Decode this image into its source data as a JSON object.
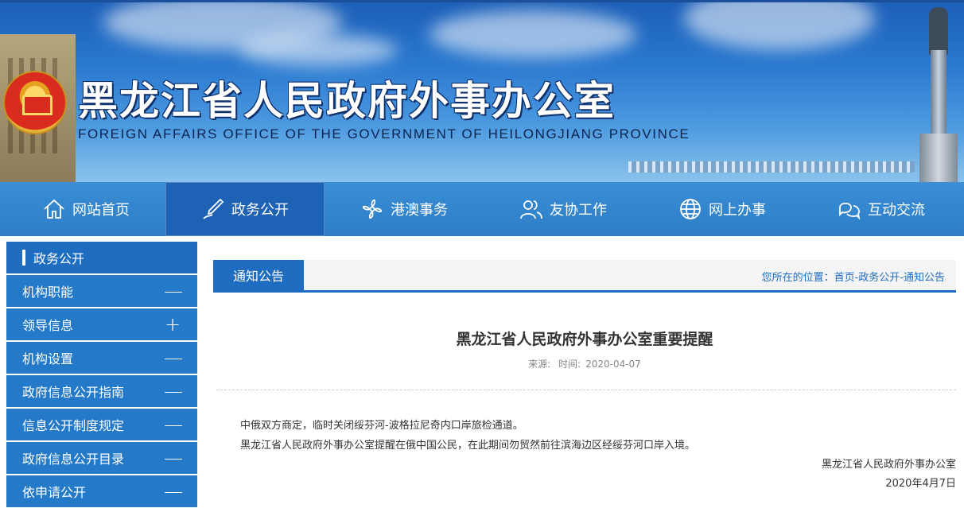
{
  "header": {
    "title_cn": "黑龙江省人民政府外事办公室",
    "title_en": "FOREIGN AFFAIRS OFFICE OF THE GOVERNMENT OF HEILONGJIANG PROVINCE"
  },
  "nav": {
    "items": [
      {
        "label": "网站首页",
        "icon": "home-icon"
      },
      {
        "label": "政务公开",
        "icon": "pen-icon",
        "active": true
      },
      {
        "label": "港澳事务",
        "icon": "flower-icon"
      },
      {
        "label": "友协工作",
        "icon": "people-icon"
      },
      {
        "label": "网上办事",
        "icon": "globe-icon"
      },
      {
        "label": "互动交流",
        "icon": "chat-icon"
      }
    ]
  },
  "sidebar": {
    "title": "政务公开",
    "items": [
      {
        "label": "机构职能",
        "toggle": "—"
      },
      {
        "label": "领导信息",
        "toggle": "+"
      },
      {
        "label": "机构设置",
        "toggle": "—"
      },
      {
        "label": "政府信息公开指南",
        "toggle": "—"
      },
      {
        "label": "信息公开制度规定",
        "toggle": "—"
      },
      {
        "label": "政府信息公开目录",
        "toggle": "—"
      },
      {
        "label": "依申请公开",
        "toggle": "—"
      }
    ]
  },
  "content": {
    "tab": "通知公告",
    "breadcrumb": "您所在的位置：首页-政务公开-通知公告",
    "article": {
      "title": "黑龙江省人民政府外事办公室重要提醒",
      "source_label": "来源:",
      "time_label": "时间:",
      "date": "2020-04-07",
      "paragraphs": [
        "中俄双方商定，临时关闭绥芬河-波格拉尼奇内口岸旅检通道。",
        "黑龙江省人民政府外事办公室提醒在俄中国公民，在此期间勿贸然前往滨海边区经绥芬河口岸入境。"
      ],
      "signature": "黑龙江省人民政府外事办公室",
      "sign_date": "2020年4月7日"
    }
  },
  "colors": {
    "primary": "#1f6dc0",
    "nav_bg": "#3a8fd6",
    "sidebar_item": "#2479c9"
  }
}
